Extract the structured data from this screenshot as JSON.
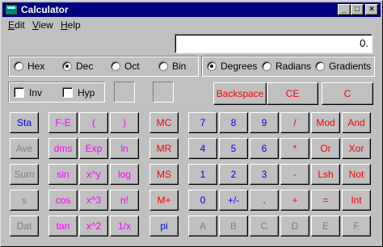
{
  "window": {
    "title": "Calculator",
    "caption_buttons": [
      "_",
      "□",
      "×"
    ]
  },
  "menu": [
    {
      "label": "Edit",
      "underline": "E",
      "rest": "dit"
    },
    {
      "label": "View",
      "underline": "V",
      "rest": "iew"
    },
    {
      "label": "Help",
      "underline": "H",
      "rest": "elp"
    }
  ],
  "display": {
    "value": "0."
  },
  "number_system": {
    "options": [
      "Hex",
      "Dec",
      "Oct",
      "Bin"
    ],
    "selected": "Dec"
  },
  "angle_units": {
    "options": [
      "Degrees",
      "Radians",
      "Gradients"
    ],
    "selected": "Degrees"
  },
  "checkboxes": {
    "inv": "Inv",
    "hyp": "Hyp"
  },
  "edit_buttons": {
    "backspace": "Backspace",
    "ce": "CE",
    "c": "C"
  },
  "colors": {
    "blue": "#0000ff",
    "red": "#ff0000",
    "magenta": "#ff00ff",
    "disabled": "#808080",
    "titlebar": "#000080"
  },
  "keypad": {
    "col_stat": [
      "Sta",
      "Ave",
      "Sum",
      "s",
      "Dat"
    ],
    "col_sci1": [
      "F-E",
      "dms",
      "sin",
      "cos",
      "tan"
    ],
    "col_sci2": [
      "(",
      "Exp",
      "x^y",
      "x^3",
      "x^2"
    ],
    "col_sci3": [
      ")",
      "ln",
      "log",
      "n!",
      "1/x"
    ],
    "col_mem": [
      "MC",
      "MR",
      "MS",
      "M+",
      "pi"
    ],
    "col_num1": [
      "7",
      "4",
      "1",
      "0",
      "A"
    ],
    "col_num2": [
      "8",
      "5",
      "2",
      "+/-",
      "B"
    ],
    "col_num3": [
      "9",
      "6",
      "3",
      ".",
      "C"
    ],
    "col_op1": [
      "/",
      "*",
      "-",
      "+",
      "D"
    ],
    "col_op2": [
      "Mod",
      "Or",
      "Lsh",
      "=",
      "E"
    ],
    "col_op3": [
      "And",
      "Xor",
      "Not",
      "Int",
      "F"
    ]
  }
}
